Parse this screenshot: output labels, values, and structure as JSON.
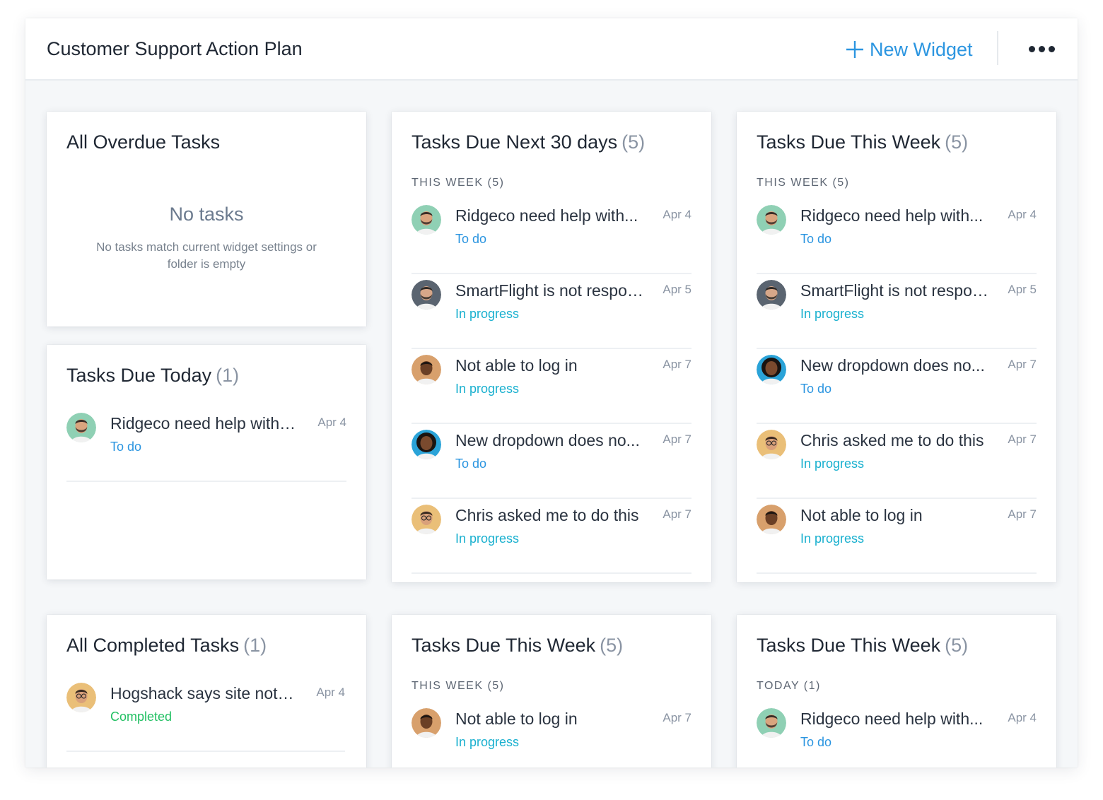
{
  "header": {
    "title": "Customer Support Action Plan",
    "new_widget_label": "New Widget",
    "more_icon": "more-horizontal-icon"
  },
  "colors": {
    "accent": "#2b95e0",
    "status_todo": "#2b95e0",
    "status_in_progress": "#19b0cf",
    "status_completed": "#22c063"
  },
  "widgets": {
    "overdue": {
      "title": "All Overdue Tasks",
      "empty_title": "No tasks",
      "empty_text": "No tasks match current widget settings or folder is empty"
    },
    "today": {
      "title": "Tasks Due Today",
      "count": "(1)",
      "tasks": [
        {
          "title": "Ridgeco need help with O...",
          "date": "Apr 4",
          "status": "To do",
          "avatar": "avatar-bearded-man-green"
        }
      ]
    },
    "next30": {
      "title": "Tasks Due Next 30 days",
      "count": "(5)",
      "section": "THIS WEEK (5)",
      "tasks": [
        {
          "title": "Ridgeco need help with...",
          "date": "Apr 4",
          "status": "To do",
          "avatar": "avatar-bearded-man-green"
        },
        {
          "title": "SmartFlight is not respon...",
          "date": "Apr 5",
          "status": "In progress",
          "avatar": "avatar-man-gray"
        },
        {
          "title": "Not able to log in",
          "date": "Apr 7",
          "status": "In progress",
          "avatar": "avatar-man-smiling"
        },
        {
          "title": "New dropdown does no...",
          "date": "Apr 7",
          "status": "To do",
          "avatar": "avatar-woman-curly"
        },
        {
          "title": "Chris asked me to do this",
          "date": "Apr 7",
          "status": "In progress",
          "avatar": "avatar-man-glasses"
        }
      ]
    },
    "week_top_right": {
      "title": "Tasks Due This Week",
      "count": "(5)",
      "section": "THIS WEEK (5)",
      "tasks": [
        {
          "title": "Ridgeco need help with...",
          "date": "Apr 4",
          "status": "To do",
          "avatar": "avatar-bearded-man-green"
        },
        {
          "title": "SmartFlight is not respon...",
          "date": "Apr 5",
          "status": "In progress",
          "avatar": "avatar-man-gray"
        },
        {
          "title": "New dropdown does no...",
          "date": "Apr 7",
          "status": "To do",
          "avatar": "avatar-woman-curly"
        },
        {
          "title": "Chris asked me to do this",
          "date": "Apr 7",
          "status": "In progress",
          "avatar": "avatar-man-glasses"
        },
        {
          "title": "Not able to log in",
          "date": "Apr 7",
          "status": "In progress",
          "avatar": "avatar-man-smiling"
        }
      ]
    },
    "completed": {
      "title": "All Completed Tasks",
      "count": "(1)",
      "tasks": [
        {
          "title": "Hogshack says site not s...",
          "date": "Apr 4",
          "status": "Completed",
          "avatar": "avatar-man-glasses"
        }
      ]
    },
    "week_bottom_mid": {
      "title": "Tasks Due This Week",
      "count": "(5)",
      "section": "THIS WEEK (5)",
      "tasks": [
        {
          "title": "Not able to log in",
          "date": "Apr 7",
          "status": "In progress",
          "avatar": "avatar-man-smiling"
        }
      ]
    },
    "week_bottom_right": {
      "title": "Tasks Due This Week",
      "count": "(5)",
      "section": "TODAY (1)",
      "tasks": [
        {
          "title": "Ridgeco need help with...",
          "date": "Apr 4",
          "status": "To do",
          "avatar": "avatar-bearded-man-green"
        }
      ]
    }
  }
}
